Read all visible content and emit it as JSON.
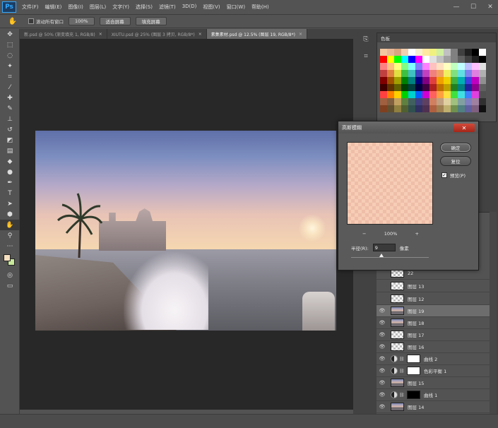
{
  "app": {
    "logo": "Ps"
  },
  "menu": [
    "文件(F)",
    "编辑(E)",
    "图像(I)",
    "图层(L)",
    "文字(Y)",
    "选择(S)",
    "滤镜(T)",
    "3D(D)",
    "视图(V)",
    "窗口(W)",
    "帮助(H)"
  ],
  "window_controls": {
    "minimize": "—",
    "restore": "☐",
    "close": "✕"
  },
  "options": {
    "hand_icon": "hand-icon",
    "scroll_all_label": "滚动所有窗口",
    "zoom_button": "100%",
    "fit_button": "适合屏幕",
    "fill_button": "填充屏幕"
  },
  "tabs": [
    {
      "label": "新.psd @ 50% (渐变填充 1, RGB/8)",
      "close": "×",
      "active": false
    },
    {
      "label": "XIUTU.psd @ 25% (图层 3 拷贝, RGB/8*)",
      "close": "×",
      "active": false
    },
    {
      "label": "素集素材.psd @ 12.5% (图层 19, RGB/8*)",
      "close": "×",
      "active": true
    }
  ],
  "swatches_panel": {
    "title": "色板"
  },
  "colors": {
    "accent": "#31a8ff",
    "close_red": "#c0392b",
    "panel_bg": "#535353",
    "canvas_bg": "#282828",
    "foreground_swatch": "#f5dfc0",
    "background_swatch": "#c8e89a"
  },
  "swatches": [
    "#f2c6a0",
    "#e8b896",
    "#d8a680",
    "#f0d0b0",
    "#ffffff",
    "#f8f0d0",
    "#ffe8a0",
    "#f0f080",
    "#d0f0a0",
    "#c0c0c0",
    "#808080",
    "#404040",
    "#202020",
    "#000000",
    "#ffffff",
    "#ff0000",
    "#ffff00",
    "#00ff00",
    "#00ffff",
    "#0000ff",
    "#ff00ff",
    "#ffffff",
    "#e0e0e0",
    "#c0c0c0",
    "#a0a0a0",
    "#808080",
    "#606060",
    "#404040",
    "#202020",
    "#000000",
    "#ff8080",
    "#ffc080",
    "#ffff80",
    "#80ff80",
    "#80ffff",
    "#8080ff",
    "#ff80ff",
    "#ffc0c0",
    "#ffe0c0",
    "#ffffc0",
    "#c0ffc0",
    "#c0ffff",
    "#c0c0ff",
    "#ffc0ff",
    "#e0e0e0",
    "#c04040",
    "#e08040",
    "#e0e040",
    "#40c040",
    "#40c0c0",
    "#4040c0",
    "#c040c0",
    "#f08080",
    "#f0a060",
    "#f0f060",
    "#80e080",
    "#60e0e0",
    "#8080f0",
    "#e080e0",
    "#b0b0b0",
    "#800000",
    "#a05000",
    "#a0a000",
    "#008000",
    "#008080",
    "#000080",
    "#800080",
    "#e04040",
    "#f0a000",
    "#f0d000",
    "#40b040",
    "#00b0b0",
    "#4040e0",
    "#c000c0",
    "#909090",
    "#400000",
    "#603000",
    "#606000",
    "#004000",
    "#004040",
    "#000040",
    "#400040",
    "#b02020",
    "#c07000",
    "#c0a000",
    "#208020",
    "#008080",
    "#2020a0",
    "#900090",
    "#606060",
    "#ff4040",
    "#ff8000",
    "#ffd000",
    "#00d000",
    "#00d0d0",
    "#0060ff",
    "#d000d0",
    "#ff6060",
    "#ffa040",
    "#ffe040",
    "#40e040",
    "#40e0e0",
    "#4080ff",
    "#e040e0",
    "#505050",
    "#a06040",
    "#806040",
    "#c0a060",
    "#608040",
    "#406060",
    "#404080",
    "#604060",
    "#d08060",
    "#c0a080",
    "#e0d0a0",
    "#a0c080",
    "#80a0a0",
    "#8080c0",
    "#a080a0",
    "#303030",
    "#804020",
    "#605030",
    "#908040",
    "#506030",
    "#305050",
    "#303060",
    "#503050",
    "#b06040",
    "#a08050",
    "#c0b070",
    "#709050",
    "#508080",
    "#6060a0",
    "#806080",
    "#101010"
  ],
  "dialog": {
    "title": "高斯模糊",
    "close": "✕",
    "ok": "确定",
    "reset": "复位",
    "preview_label": "预览(P)",
    "preview_checked": "✓",
    "zoom_out": "−",
    "zoom_level": "100%",
    "zoom_in": "+",
    "radius_label": "半径(R):",
    "radius_value": "9",
    "radius_unit": "像素"
  },
  "layers": [
    {
      "eye": "",
      "thumb": "check",
      "name": "22"
    },
    {
      "eye": "",
      "thumb": "check",
      "name": "图层 13"
    },
    {
      "eye": "",
      "thumb": "check",
      "name": "图层 12"
    },
    {
      "eye": "👁",
      "thumb": "photo",
      "name": "图层 19",
      "selected": true
    },
    {
      "eye": "👁",
      "thumb": "photo",
      "name": "图层 18"
    },
    {
      "eye": "👁",
      "thumb": "check",
      "name": "图层 17"
    },
    {
      "eye": "👁",
      "thumb": "check",
      "name": "图层 16"
    },
    {
      "eye": "👁",
      "thumb": "white",
      "name": "曲线 2",
      "adjust": true
    },
    {
      "eye": "👁",
      "thumb": "white",
      "name": "色彩平衡 1",
      "adjust": true
    },
    {
      "eye": "👁",
      "thumb": "photo",
      "name": "图层 15"
    },
    {
      "eye": "👁",
      "thumb": "black",
      "name": "曲线 1",
      "adjust": true
    },
    {
      "eye": "👁",
      "thumb": "photo",
      "name": "图层 14"
    }
  ]
}
